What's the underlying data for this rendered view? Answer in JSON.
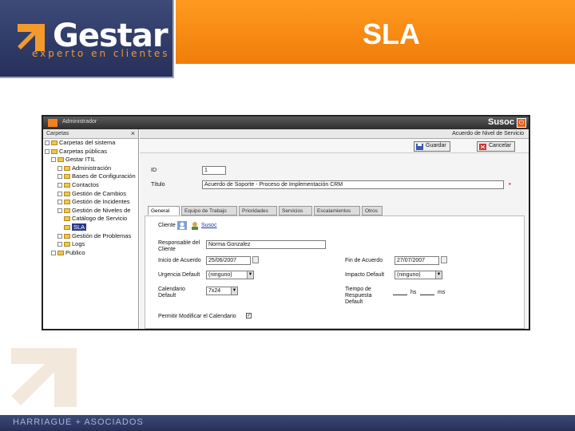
{
  "slide": {
    "logo_name": "Gestar",
    "logo_tagline": "experto en clientes",
    "title": "SLA",
    "footer": "HARRIAGUE + ASOCIADOS",
    "brand_colors": {
      "orange": "#f07d0a",
      "navy": "#2b3560"
    }
  },
  "app": {
    "user": "Administrador",
    "brand": "Susoc",
    "left_panel": {
      "title": "Carpetas",
      "tree": [
        {
          "label": "Carpetas del sistema",
          "type": "folder"
        },
        {
          "label": "Carpetas públicas",
          "type": "folder"
        },
        {
          "label": "Gestar ITIL",
          "type": "folder"
        },
        {
          "label": "Administración",
          "type": "folder"
        },
        {
          "label": "Bases de Configuración",
          "type": "folder"
        },
        {
          "label": "Contactos",
          "type": "folder"
        },
        {
          "label": "Gestión de Cambios",
          "type": "folder"
        },
        {
          "label": "Gestión de Incidentes",
          "type": "folder"
        },
        {
          "label": "Gestión de Niveles de",
          "type": "folder"
        },
        {
          "label": "Catálogo de Servicio",
          "type": "folder"
        },
        {
          "label": "SLA",
          "type": "folder",
          "selected": true
        },
        {
          "label": "Gestión de Problemas",
          "type": "folder"
        },
        {
          "label": "Logs",
          "type": "folder"
        },
        {
          "label": "Publico",
          "type": "folder"
        }
      ]
    },
    "right_panel": {
      "header": "Acuerdo de Nivel de Servicio",
      "save_label": "Guardar",
      "cancel_label": "Cancelar",
      "fields": {
        "id_label": "ID",
        "id_value": "1",
        "title_label": "Título",
        "title_value": "Acuerdo de Soporte - Proceso de Implementación CRM"
      },
      "tabs": [
        "General",
        "Equipo de Trabajo",
        "Prioridades",
        "Servicios",
        "Escalamientos",
        "Otros"
      ],
      "general": {
        "client_label": "Cliente",
        "client_value": "Susoc",
        "contact_label": "Responsable del Cliente",
        "contact_value": "Norma Gonzalez",
        "start_label": "Inicio de Acuerdo",
        "start_value": "25/06/2007",
        "end_label": "Fin de Acuerdo",
        "end_value": "27/07/2007",
        "urgency_label": "Urgencia Default",
        "urgency_value": "(ninguno)",
        "impact_label": "Impacto Default",
        "impact_value": "(ninguno)",
        "calendar_label": "Calendario Default",
        "calendar_value": "7x24",
        "response_label": "Tiempo de Respuesta Default",
        "hs_label": "hs",
        "ms_label": "ms",
        "allow_label": "Permitir Modificar el Calendario",
        "allow_checked": true
      }
    }
  }
}
